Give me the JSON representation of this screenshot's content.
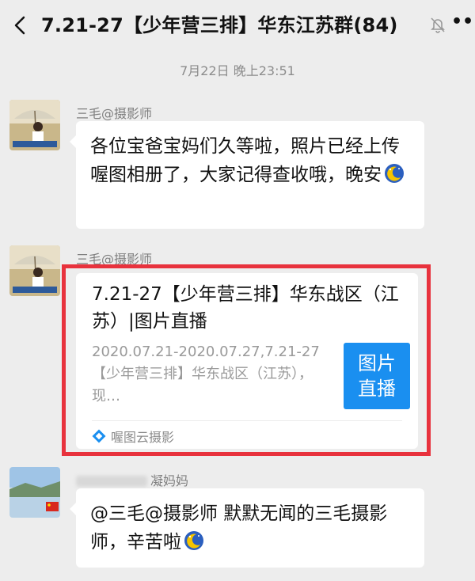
{
  "header": {
    "title": "7.21-27【少年营三排】华东江苏群(84)"
  },
  "timestamp": "7月22日 晚上23:51",
  "messages": [
    {
      "sender": "三毛@摄影师",
      "text": "各位宝爸宝妈们久等啦，照片已经上传喔图相册了，大家记得查收哦，晚安"
    },
    {
      "sender": "三毛@摄影师",
      "card": {
        "title": "7.21-27【少年营三排】华东战区（江苏）|图片直播",
        "description": "2020.07.21-2020.07.27,7.21-27【少年营三排】华东战区（江苏），现…",
        "thumb_label": "图片直播",
        "source": "喔图云摄影"
      }
    },
    {
      "sender_suffix": "凝妈妈",
      "text": "@三毛@摄影师  默默无闻的三毛摄影师，辛苦啦"
    }
  ],
  "colors": {
    "highlight": "#e8323d",
    "thumb": "#1a8ff0",
    "background": "#ededed"
  }
}
